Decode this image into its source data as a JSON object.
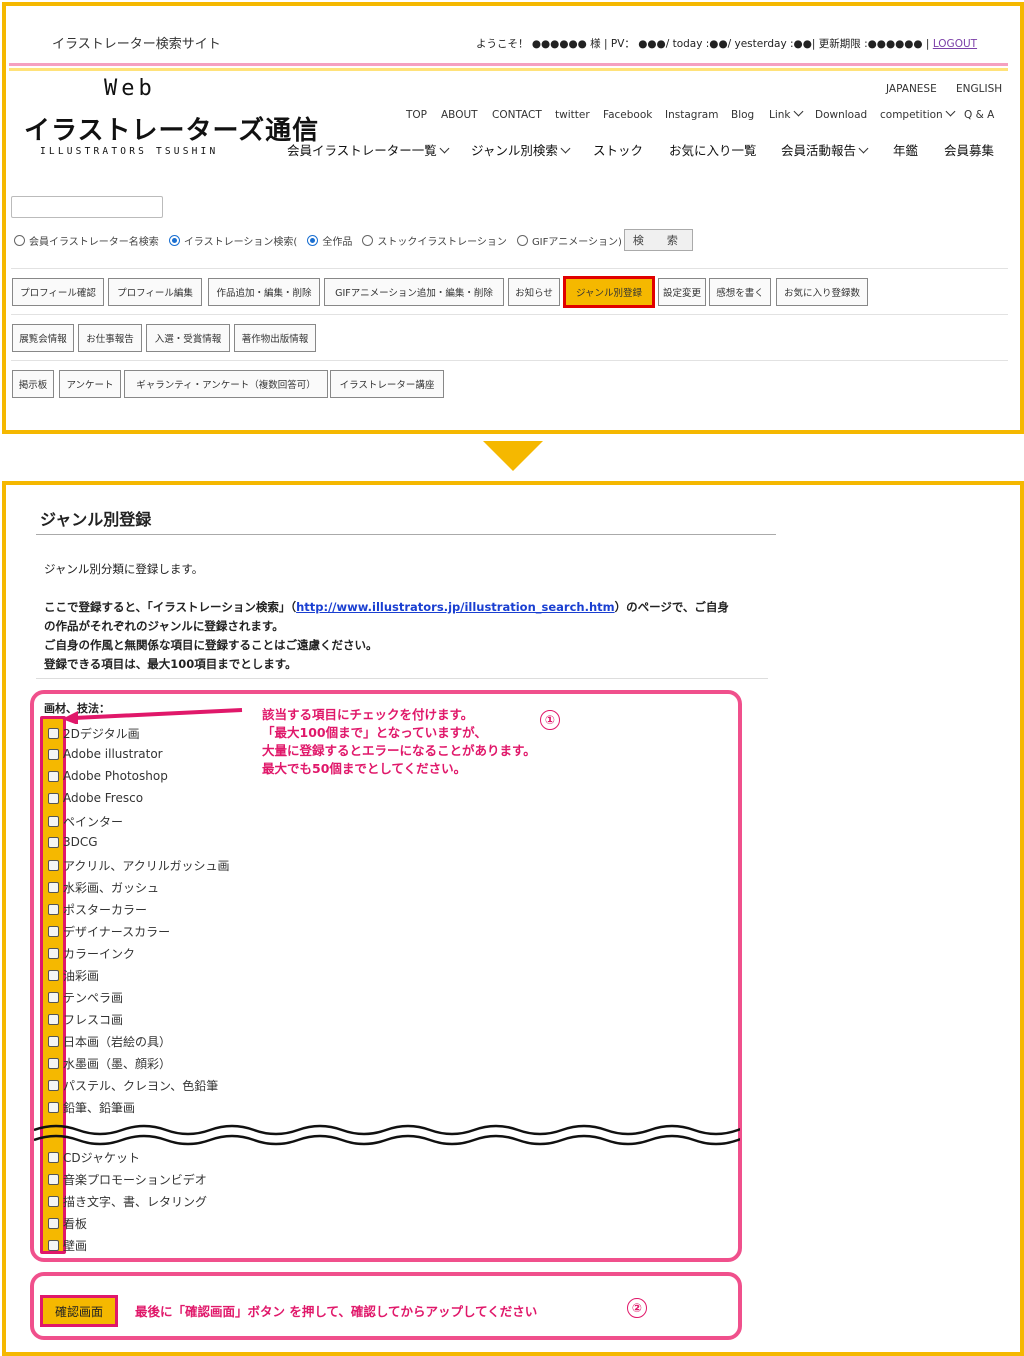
{
  "header": {
    "site_name": "イラストレーター検索サイト",
    "userbar_text": "ようこそ！ ●●●●●● 様 | PV： ●●●/ today :●●/ yesterday :●●| 更新期限 :●●●●●● | ",
    "logout_label": "LOGOUT",
    "logo_web": "Web",
    "logo_main": "イラストレーターズ通信",
    "logo_sub": "ILLUSTRATORS TSUSHIN",
    "lang": [
      "JAPANESE",
      "ENGLISH"
    ],
    "topnav": [
      "TOP",
      "ABOUT",
      "CONTACT",
      "twitter",
      "Facebook",
      "Instagram",
      "Blog",
      "Link",
      "Download",
      "competition",
      "Q & A"
    ],
    "mainnav": [
      "会員イラストレーター一覧",
      "ジャンル別検索",
      "ストック",
      "お気に入り一覧",
      "会員活動報告",
      "年鑑",
      "会員募集"
    ]
  },
  "search": {
    "radios": [
      "会員イラストレーター名検索",
      "イラストレーション検索(",
      "全作品",
      "ストックイラストレーション",
      "GIFアニメーション)"
    ],
    "button_label": "検　索"
  },
  "toolbar": {
    "row1": [
      "プロフィール確認",
      "プロフィール編集",
      "作品追加・編集・削除",
      "GIFアニメーション追加・編集・削除",
      "お知らせ",
      "ジャンル別登録",
      "設定変更",
      "感想を書く",
      "お気に入り登録数"
    ],
    "row2": [
      "展覧会情報",
      "お仕事報告",
      "入選・受賞情報",
      "著作物出版情報"
    ],
    "row3": [
      "掲示板",
      "アンケート",
      "ギャランティ・アンケート（複数回答可）",
      "イラストレーター講座"
    ]
  },
  "page": {
    "title": "ジャンル別登録",
    "intro": "ジャンル別分類に登録します。",
    "desc_before_link": "ここで登録すると、「イラストレーション検索」（",
    "link": "http://www.illustrators.jp/illustration_search.htm",
    "desc_after_link": "）のページで、ご自身",
    "desc_line2": "の作品がそれぞれのジャンルに登録されます。",
    "desc_line3": "ご自身の作風と無関係な項目に登録することはご遠慮ください。",
    "desc_line4": "登録できる項目は、最大100項目までとします。"
  },
  "category": {
    "label": "画材、技法：",
    "options_top": [
      "2Dデジタル画",
      "Adobe illustrator",
      "Adobe Photoshop",
      "Adobe Fresco",
      "ペインター",
      "3DCG",
      "アクリル、アクリルガッシュ画",
      "水彩画、ガッシュ",
      "ポスターカラー",
      "デザイナースカラー",
      "カラーインク",
      "油彩画",
      "テンペラ画",
      "フレスコ画",
      "日本画（岩絵の具）",
      "水墨画（墨、顔彩）",
      "パステル、クレヨン、色鉛筆",
      "鉛筆、鉛筆画"
    ],
    "options_bottom": [
      "CDジャケット",
      "音楽プロモーションビデオ",
      "描き文字、書、レタリング",
      "看板",
      "壁画"
    ]
  },
  "annotation": {
    "lines": [
      "該当する項目にチェックを付けます。",
      "「最大100個まで」となっていますが、",
      "大量に登録するとエラーになることがあります。",
      "最大でも50個までとしてください。"
    ],
    "num1": "①",
    "num2": "②"
  },
  "confirm": {
    "button_label": "確認画面",
    "note": "最後に「確認画面」ボタン を押して、確認してからアップしてください"
  },
  "colors": {
    "accent_yellow": "#f5b800",
    "annotation_pink": "#e0186a",
    "highlight_red": "#e00000"
  }
}
